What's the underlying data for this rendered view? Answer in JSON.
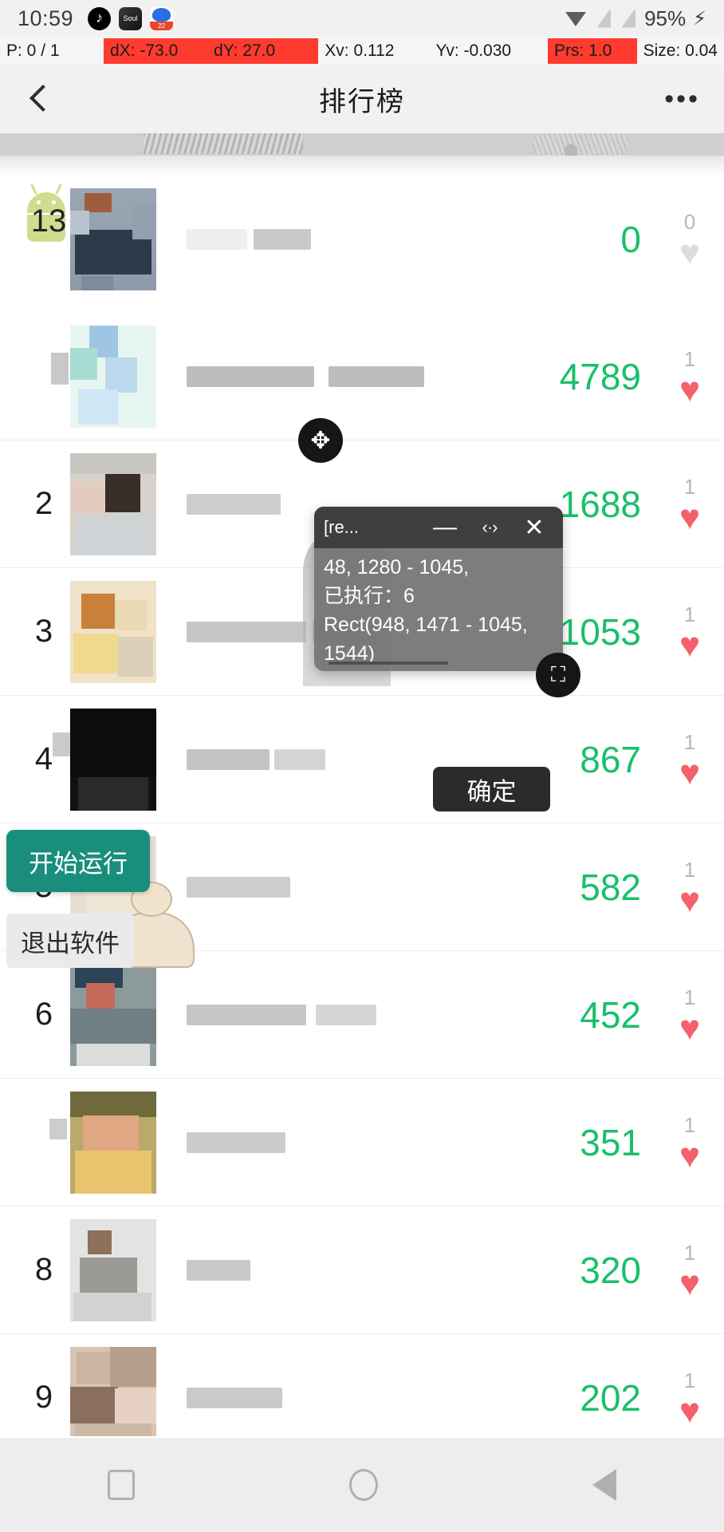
{
  "status_bar": {
    "time": "10:59",
    "battery": "95%",
    "icons": [
      "tiktok-app-icon",
      "soul-app-icon",
      "baidu-app-icon",
      "wifi-icon",
      "signal-icon",
      "signal-icon",
      "charging-bolt-icon"
    ]
  },
  "pointer_bar": {
    "pointer": "P: 0 / 1",
    "dx": "dX: -73.0",
    "dy": "dY: 27.0",
    "xv": "Xv: 0.112",
    "yv": "Yv: -0.030",
    "prs": "Prs: 1.0",
    "size": "Size: 0.04",
    "highlight_color": "#ff3b30"
  },
  "header": {
    "title": "排行榜",
    "back_icon": "chevron-left-icon",
    "more_icon": "overflow-menu-icon"
  },
  "floating_buttons": {
    "start": "开始运行",
    "exit": "退出软件",
    "start_color": "#1a8e7c"
  },
  "dialog": {
    "title": "[re...",
    "minimize": "—",
    "resize": "‹·›",
    "close": "✕",
    "lines": [
      "48, 1280 - 1045,",
      "已执行：6",
      "Rect(948, 1471 - 1045,",
      "1544)"
    ],
    "confirm": "确定",
    "move_icon": "move-cross-icon",
    "expand_icon": "expand-arrows-icon"
  },
  "list": {
    "rows": [
      {
        "rank": "13",
        "score": "0",
        "likes": "0",
        "liked": false,
        "avatar": "avatar-blurred-1",
        "first": true
      },
      {
        "rank": "",
        "score": "4789",
        "likes": "1",
        "liked": true,
        "avatar": "avatar-blurred-2",
        "first": false
      },
      {
        "rank": "2",
        "score": "1688",
        "likes": "1",
        "liked": true,
        "avatar": "avatar-blurred-3",
        "first": false
      },
      {
        "rank": "3",
        "score": "1053",
        "likes": "1",
        "liked": true,
        "avatar": "avatar-blurred-4",
        "first": false
      },
      {
        "rank": "4",
        "score": "867",
        "likes": "1",
        "liked": true,
        "avatar": "avatar-blurred-5",
        "first": false
      },
      {
        "rank": "5",
        "score": "582",
        "likes": "1",
        "liked": true,
        "avatar": "avatar-blurred-6",
        "first": false
      },
      {
        "rank": "6",
        "score": "452",
        "likes": "1",
        "liked": true,
        "avatar": "avatar-blurred-7",
        "first": false
      },
      {
        "rank": "",
        "score": "351",
        "likes": "1",
        "liked": true,
        "avatar": "avatar-blurred-8",
        "first": false
      },
      {
        "rank": "8",
        "score": "320",
        "likes": "1",
        "liked": true,
        "avatar": "avatar-blurred-9",
        "first": false
      },
      {
        "rank": "9",
        "score": "202",
        "likes": "1",
        "liked": true,
        "avatar": "avatar-blurred-10",
        "first": false
      }
    ],
    "score_color": "#18c06a",
    "heart_color": "#f4616b"
  },
  "nav_bar": {
    "recents": "recents-square-icon",
    "home": "home-circle-icon",
    "back": "back-triangle-icon"
  }
}
